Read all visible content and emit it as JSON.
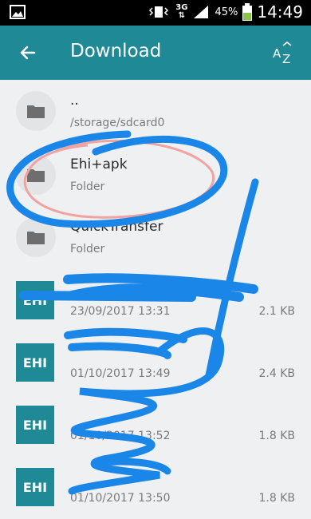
{
  "status_bar": {
    "network_type": "3G",
    "battery_percent": "45%",
    "time": "14:49",
    "icons": [
      "image-icon",
      "vibrate-icon",
      "data-arrows-icon",
      "signal-icon",
      "battery-icon"
    ]
  },
  "app_bar": {
    "title": "Download",
    "back_icon": "arrow-left-icon",
    "sort_label_a": "A",
    "sort_label_z": "Z"
  },
  "files": [
    {
      "kind": "folder",
      "name": "..",
      "subtitle": "/storage/sdcard0"
    },
    {
      "kind": "folder",
      "name": "Ehi+apk",
      "subtitle": "Folder"
    },
    {
      "kind": "folder",
      "name": "QuickTransfer",
      "subtitle": "Folder"
    },
    {
      "kind": "file",
      "badge": "EHI",
      "name": "",
      "subtitle": "23/09/2017 13:31",
      "size": "2.1 KB"
    },
    {
      "kind": "file",
      "badge": "EHI",
      "name": "",
      "subtitle": "01/10/2017 13:49",
      "size": "2.4 KB"
    },
    {
      "kind": "file",
      "badge": "EHI",
      "name": "",
      "subtitle": "01/10/2017 13:52",
      "size": "1.8 KB"
    },
    {
      "kind": "file",
      "badge": "EHI",
      "name": "",
      "subtitle": "01/10/2017 13:50",
      "size": "1.8 KB"
    }
  ],
  "colors": {
    "app_bar": "#1f8a95",
    "file_tile": "#1f8a95",
    "scribble_blue": "#1a86e8",
    "scribble_pink": "#f0a3a0"
  }
}
